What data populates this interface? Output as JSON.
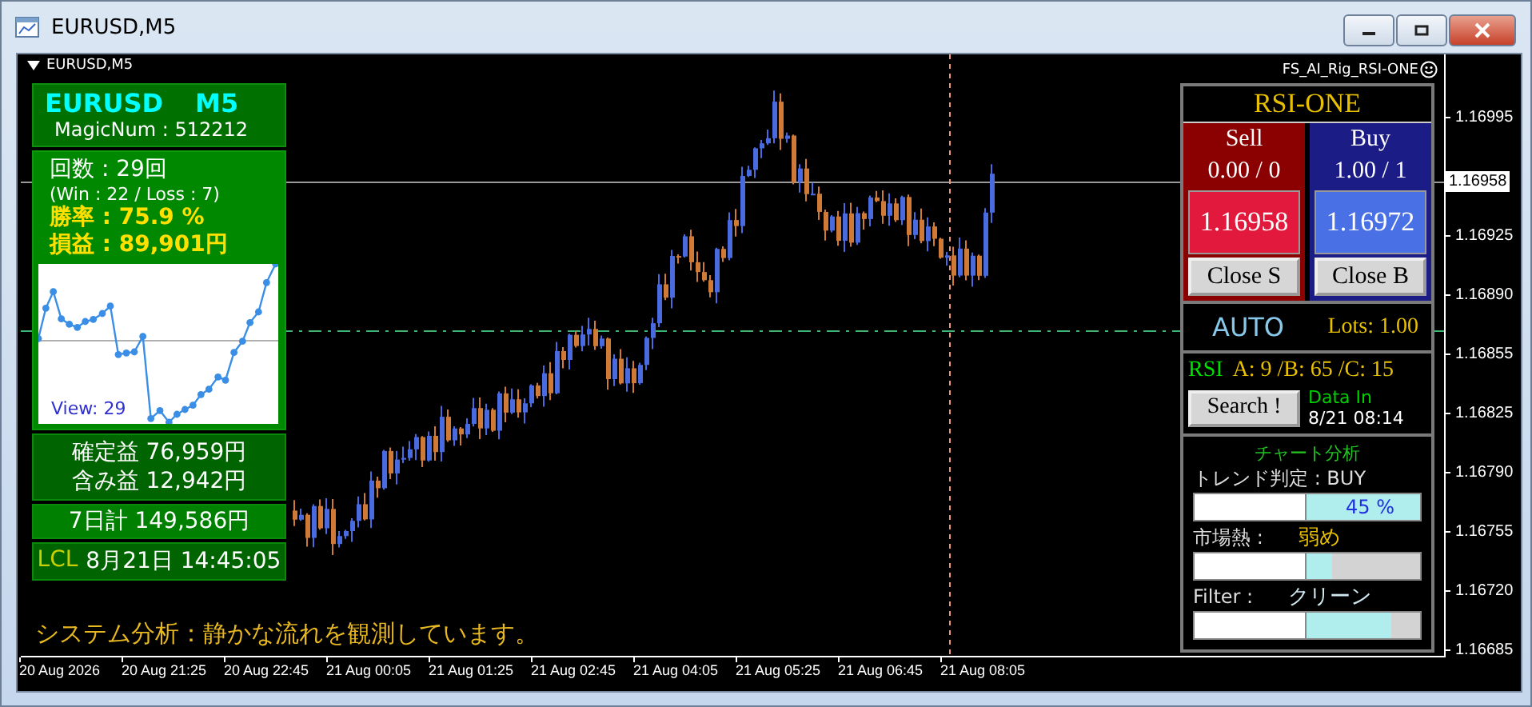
{
  "window": {
    "title": "EURUSD,M5"
  },
  "chart": {
    "symbol_label": "EURUSD,M5",
    "indicator_label": "FS_AI_Rig_RSI-ONE",
    "current_price": "1.16958",
    "price_axis": [
      "1.16995",
      "1.16925",
      "1.16890",
      "1.16855",
      "1.16825",
      "1.16790",
      "1.16755",
      "1.16720",
      "1.16685"
    ],
    "time_axis": [
      "20 Aug 2026",
      "20 Aug 21:25",
      "20 Aug 22:45",
      "21 Aug 00:05",
      "21 Aug 01:25",
      "21 Aug 02:45",
      "21 Aug 04:05",
      "21 Aug 05:25",
      "21 Aug 06:45",
      "21 Aug 08:05"
    ],
    "message": "システム分析：静かな流れを観測しています。"
  },
  "left_panel": {
    "symbol": "EURUSD",
    "timeframe": "M5",
    "magic": "MagicNum : 512212",
    "trades": "回数 : 29回",
    "win_loss": "(Win : 22 /  Loss : 7)",
    "win_rate": "勝率 : 75.9 %",
    "profit": "損益 : 89,901円",
    "equity_view": "View: 29",
    "realized": "確定益 76,959円",
    "unrealized": "含み益 12,942円",
    "week_total": "7日計 149,586円",
    "clock_label": "LCL",
    "clock": "8月21日 14:45:05"
  },
  "right_panel": {
    "title": "RSI-ONE",
    "sides": [
      {
        "kind": "sell",
        "label": "Sell",
        "position": "0.00 / 0",
        "price": "1.16958",
        "close": "Close S"
      },
      {
        "kind": "buy",
        "label": "Buy",
        "position": "1.00 / 1",
        "price": "1.16972",
        "close": "Close B"
      }
    ],
    "mode": "AUTO",
    "lots": "Lots: 1.00",
    "rsi_label": "RSI",
    "rsi_values": "A: 9 /B: 65 /C: 15",
    "search": "Search !",
    "data_in_label": "Data In",
    "data_in_time": "8/21 08:14",
    "analysis_title": "チャート分析",
    "meters": [
      {
        "kind": "inside",
        "label": "トレンド判定 : BUY",
        "value": "45 %",
        "level": 1.0
      },
      {
        "kind": "beside",
        "label": "市場熱 :",
        "value": "弱め",
        "level": 0.22
      },
      {
        "kind": "beside",
        "label": "Filter :",
        "value": "クリーン",
        "level": 0.74
      }
    ]
  }
}
